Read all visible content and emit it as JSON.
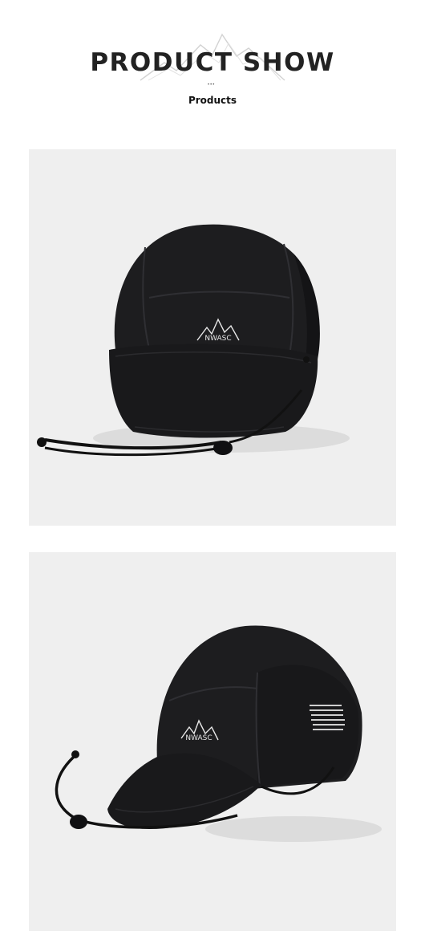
{
  "header": {
    "title": "PRODUCT SHOW",
    "divider_dots": "•••",
    "subtitle": "Products"
  },
  "photos": [
    {
      "subject": "black 5-panel camp cap, front view",
      "logo_text": "NWASC"
    },
    {
      "subject": "black 5-panel camp cap, three-quarter view",
      "logo_text": "NWASC"
    }
  ],
  "colors": {
    "cap": "#1b1b1d",
    "photo_bg": "#efefef",
    "title": "#222222"
  }
}
